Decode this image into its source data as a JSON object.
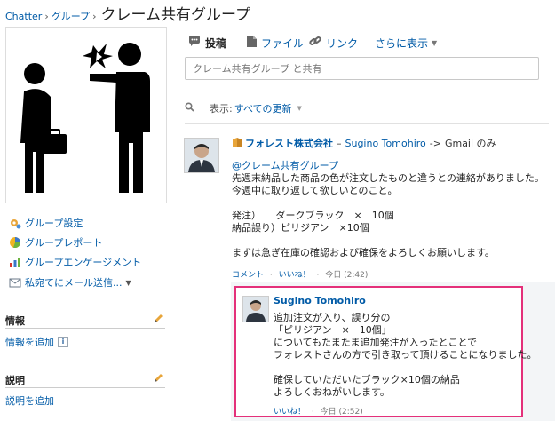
{
  "breadcrumb": {
    "items": [
      "Chatter",
      "グループ"
    ],
    "separator": "›",
    "title": "クレーム共有グループ"
  },
  "sidebar": {
    "links": [
      {
        "label": "グループ設定",
        "icon": "settings-icon"
      },
      {
        "label": "グループレポート",
        "icon": "report-icon"
      },
      {
        "label": "グループエンゲージメント",
        "icon": "engagement-chart-icon"
      },
      {
        "label": "私宛てにメール送信...",
        "icon": "email-icon"
      }
    ],
    "info": {
      "heading": "情報",
      "link": "情報を追加"
    },
    "description": {
      "heading": "説明",
      "link": "説明を追加"
    }
  },
  "publisher": {
    "tabs": [
      {
        "label": "投稿",
        "icon": "post-icon"
      },
      {
        "label": "ファイル",
        "icon": "file-icon"
      },
      {
        "label": "リンク",
        "icon": "link-icon"
      },
      {
        "label": "さらに表示",
        "icon": "dropdown-icon"
      }
    ],
    "placeholder": "クレーム共有グループ と共有"
  },
  "filter": {
    "label": "表示:",
    "value": "すべての更新"
  },
  "post": {
    "company": "フォレスト株式会社",
    "dash": "–",
    "author": "Sugino Tomohiro",
    "arrow": "->",
    "visibility": "Gmail のみ",
    "lines": [
      "@クレーム共有グループ",
      "先週末納品した商品の色が注文したものと違うとの連絡がありました。",
      "今週中に取り返して欲しいとのこと。",
      "",
      "発注）　　ダークブラック　×　10個",
      "納品誤り）ピリジアン　×10個",
      "",
      "まずは急ぎ在庫の確認および確保をよろしくお願いします。"
    ],
    "actions": {
      "comment": "コメント",
      "like": "いいね！",
      "time": "今日 (2:42)"
    }
  },
  "reply": {
    "author": "Sugino Tomohiro",
    "lines": [
      "追加注文が入り、誤り分の",
      "「ピリジアン　×　10個」",
      "についてもたまたま追加発注が入ったとことで",
      "フォレストさんの方で引き取って頂けることになりました。",
      "",
      "確保していただいたブラック×10個の納品",
      "よろしくおねがいします。"
    ],
    "actions": {
      "like": "いいね！",
      "time": "今日 (2:52)"
    }
  },
  "colors": {
    "link": "#015ba7",
    "highlight": "#e4307a"
  }
}
